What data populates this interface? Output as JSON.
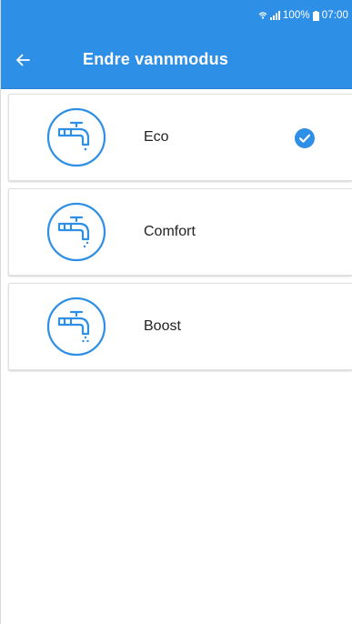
{
  "status_bar": {
    "battery": "100%",
    "time": "07:00"
  },
  "header": {
    "back_icon": "arrow-left-icon",
    "title": "Endre vannmodus"
  },
  "modes": [
    {
      "label": "Eco",
      "icon": "tap-eco-icon",
      "selected": true
    },
    {
      "label": "Comfort",
      "icon": "tap-comfort-icon",
      "selected": false
    },
    {
      "label": "Boost",
      "icon": "tap-boost-icon",
      "selected": false
    }
  ],
  "colors": {
    "primary": "#2e8fe6",
    "check": "#2e8fe6",
    "icon_stroke": "#2e8fe6"
  }
}
